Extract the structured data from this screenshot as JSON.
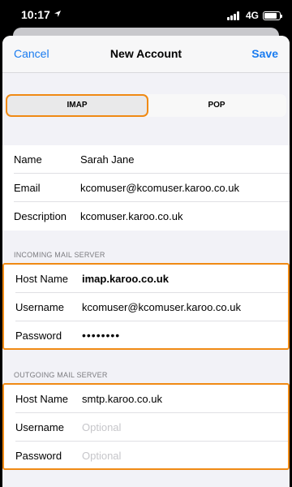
{
  "status_bar": {
    "time": "10:17",
    "network": "4G",
    "icons": [
      "location-arrow-icon",
      "signal-icon",
      "battery-icon"
    ],
    "battery_level": 0.85
  },
  "nav": {
    "cancel_label": "Cancel",
    "title": "New Account",
    "save_label": "Save"
  },
  "segment": {
    "options": [
      "IMAP",
      "POP"
    ],
    "selected": "IMAP"
  },
  "account": {
    "rows": [
      {
        "label": "Name",
        "value": "Sarah Jane"
      },
      {
        "label": "Email",
        "value": "kcomuser@kcomuser.karoo.co.uk"
      },
      {
        "label": "Description",
        "value": "kcomuser.karoo.co.uk"
      }
    ]
  },
  "incoming": {
    "header": "INCOMING MAIL SERVER",
    "rows": [
      {
        "label": "Host Name",
        "value": "imap.karoo.co.uk"
      },
      {
        "label": "Username",
        "value": "kcomuser@kcomuser.karoo.co.uk"
      },
      {
        "label": "Password",
        "value": "••••••••"
      }
    ]
  },
  "outgoing": {
    "header": "OUTGOING MAIL SERVER",
    "rows": [
      {
        "label": "Host Name",
        "value": "smtp.karoo.co.uk"
      },
      {
        "label": "Username",
        "placeholder": "Optional"
      },
      {
        "label": "Password",
        "placeholder": "Optional"
      }
    ]
  },
  "colors": {
    "accent": "#1a7cf0",
    "highlight": "#f08a14",
    "background": "#f2f2f7"
  }
}
